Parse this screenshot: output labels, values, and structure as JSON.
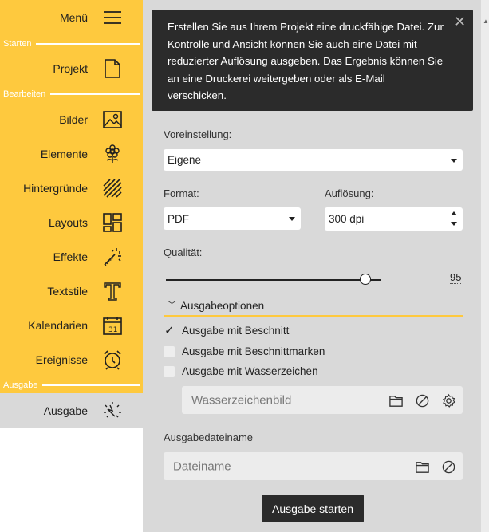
{
  "sidebar": {
    "menu_label": "Menü",
    "sections": {
      "starten": "Starten",
      "bearbeiten": "Bearbeiten",
      "ausgabe": "Ausgabe"
    },
    "items": [
      {
        "label": "Projekt",
        "icon": "document-icon"
      },
      {
        "label": "Bilder",
        "icon": "image-icon"
      },
      {
        "label": "Elemente",
        "icon": "flower-icon"
      },
      {
        "label": "Hintergründe",
        "icon": "hatch-pattern-icon"
      },
      {
        "label": "Layouts",
        "icon": "layout-icon"
      },
      {
        "label": "Effekte",
        "icon": "magic-wand-icon"
      },
      {
        "label": "Textstile",
        "icon": "text-t-icon"
      },
      {
        "label": "Kalendarien",
        "icon": "calendar-icon"
      },
      {
        "label": "Ereignisse",
        "icon": "alarm-clock-icon"
      },
      {
        "label": "Ausgabe",
        "icon": "spark-output-icon",
        "active": true
      }
    ],
    "accent_color": "#fec93e"
  },
  "info": {
    "text": "Erstellen Sie aus Ihrem Projekt eine druckfähige Datei. Zur Kontrolle und Ansicht können Sie auch eine Datei mit reduzierter Auflösung ausgeben. Das Ergebnis können Sie an eine Druckerei weitergeben oder als E-Mail verschicken.",
    "close_icon": "close-x-icon"
  },
  "form": {
    "preset_label": "Voreinstellung:",
    "preset_value": "Eigene",
    "format_label": "Format:",
    "format_value": "PDF",
    "resolution_label": "Auflösung:",
    "resolution_value": "300 dpi",
    "quality_label": "Qualität:",
    "quality_value": "95",
    "quality_fraction": 0.925,
    "options_label": "Ausgabeoptionen",
    "checkboxes": [
      {
        "label": "Ausgabe mit Beschnitt",
        "checked": true
      },
      {
        "label": "Ausgabe mit Beschnittmarken",
        "checked": false
      },
      {
        "label": "Ausgabe mit Wasserzeichen",
        "checked": false
      }
    ],
    "watermark_placeholder": "Wasserzeichenbild",
    "filename_label": "Ausgabedateiname",
    "filename_placeholder": "Dateiname",
    "start_label": "Ausgabe starten"
  }
}
